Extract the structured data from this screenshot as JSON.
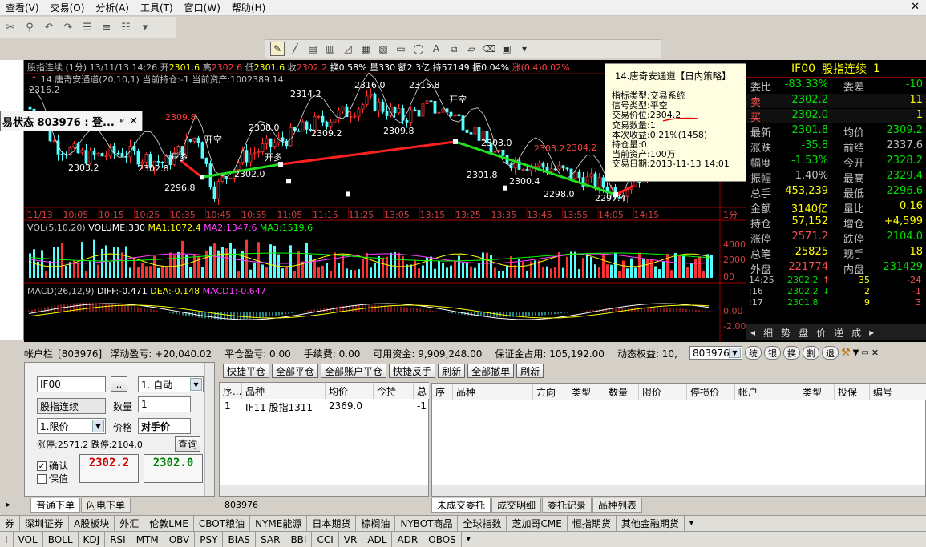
{
  "menu": [
    "查看(V)",
    "交易(O)",
    "分析(A)",
    "工具(T)",
    "窗口(W)",
    "帮助(H)"
  ],
  "chart": {
    "header": {
      "name": "股指连续",
      "period": "(1分)",
      "date": "13/11/13 14:26",
      "open_label": "开",
      "open": "2301.6",
      "high_label": "高",
      "high": "2302.6",
      "low_label": "低",
      "low": "2301.6",
      "close_label": "收",
      "close": "2302.2",
      "turnover": "换0.58%",
      "volume": "量330",
      "amount": "额2.3亿",
      "oi": "持57149",
      "amp": "振0.04%",
      "chg": "涨(0.4)0.02%"
    },
    "strategy_line": "14.唐奇安通道(20,10,1)",
    "position_text": "当前持仓:-1",
    "asset_text": "当前资产:1002389.14",
    "price_labels": [
      {
        "t": "2316.2",
        "c": "#c0c0c0"
      },
      {
        "t": "2314.2",
        "c": "#ffffff"
      },
      {
        "t": "2316.0",
        "c": "#ffffff"
      },
      {
        "t": "2315.8",
        "c": "#ffffff"
      },
      {
        "t": "2309.8",
        "c": "#ff4040"
      },
      {
        "t": "2308.0",
        "c": "#ffffff"
      },
      {
        "t": "2309.2",
        "c": "#ffffff"
      },
      {
        "t": "2309.8",
        "c": "#ffffff"
      },
      {
        "t": "2303.2",
        "c": "#ffffff"
      },
      {
        "t": "2302.8",
        "c": "#ffffff"
      },
      {
        "t": "2302.0",
        "c": "#ffffff"
      },
      {
        "t": "2301.8",
        "c": "#ffffff"
      },
      {
        "t": "2300.4",
        "c": "#ffffff"
      },
      {
        "t": "2298.0",
        "c": "#ffffff"
      },
      {
        "t": "2296.8",
        "c": "#ffffff"
      },
      {
        "t": "2297.4",
        "c": "#ffffff"
      },
      {
        "t": "2304.2",
        "c": "#ff4040"
      },
      {
        "t": "2303.2",
        "c": "#ff4040"
      },
      {
        "t": "2303.0",
        "c": "#ffffff"
      }
    ],
    "signals": [
      "开多",
      "开空",
      "开多",
      "开空"
    ],
    "time_axis": [
      "11/13",
      "10:05",
      "10:15",
      "10:25",
      "10:35",
      "10:45",
      "10:55",
      "11:05",
      "11:15",
      "11:25",
      "13:05",
      "13:15",
      "13:25",
      "13:35",
      "13:45",
      "13:55",
      "14:05",
      "14:15"
    ],
    "period_label": "1分",
    "vol_header": {
      "label": "VOL(5,10,20)",
      "volume": "VOLUME:330",
      "ma1": "MA1:1072.4",
      "ma2": "MA2:1347.6",
      "ma3": "MA3:1519.6"
    },
    "vol_axis": [
      "4000",
      "2000",
      "00"
    ],
    "macd_header": {
      "label": "MACD(26,12,9)",
      "diff": "DIFF:-0.471",
      "dea": "DEA:-0.148",
      "macd1": "MACD1:-0.647"
    },
    "macd_axis": [
      "0.00",
      "-2.00"
    ]
  },
  "popup": {
    "title": "14.唐奇安通道【日内策略】",
    "lines": [
      "指标类型:交易系统",
      "信号类型:平空",
      "交易价位:2304.2",
      "交易数量:1",
      "本次收益:0.21%(1458)",
      "持仓量:0",
      "当前资产:100万",
      "交易日期:2013-11-13 14:01"
    ]
  },
  "trade_state": {
    "title": "易状态 803976 : 登...",
    "pin": "ᵖ",
    "close": "✕"
  },
  "quote": {
    "code": "IF00",
    "name": "股指连续",
    "num": "1",
    "rows": [
      {
        "l": "委比",
        "v": "-83.33%",
        "vc": "#00e000",
        "l2": "委差",
        "v2": "-10",
        "v2c": "#00e000"
      },
      {
        "l": "卖",
        "v": "2302.2",
        "vc": "#00e000",
        "l2": "",
        "v2": "11",
        "v2c": "#ffff00",
        "lc": "#ff5050"
      },
      {
        "l": "买",
        "v": "2302.0",
        "vc": "#00e000",
        "l2": "",
        "v2": "1",
        "v2c": "#ffff00",
        "lc": "#ff5050"
      },
      {
        "l": "最新",
        "v": "2301.8",
        "vc": "#00e000",
        "l2": "均价",
        "v2": "2309.2",
        "v2c": "#00e000"
      },
      {
        "l": "涨跌",
        "v": "-35.8",
        "vc": "#00e000",
        "l2": "前结",
        "v2": "2337.6",
        "v2c": "#c0c0c0"
      },
      {
        "l": "幅度",
        "v": "-1.53%",
        "vc": "#00e000",
        "l2": "今开",
        "v2": "2328.2",
        "v2c": "#00e000"
      },
      {
        "l": "振幅",
        "v": "1.40%",
        "vc": "#c0c0c0",
        "l2": "最高",
        "v2": "2329.4",
        "v2c": "#00e000"
      },
      {
        "l": "总手",
        "v": "453,239",
        "vc": "#ffff00",
        "l2": "最低",
        "v2": "2296.6",
        "v2c": "#00e000"
      },
      {
        "l": "金额",
        "v": "3140亿",
        "vc": "#ffff00",
        "l2": "量比",
        "v2": "0.16",
        "v2c": "#ffff00"
      },
      {
        "l": "持仓",
        "v": "57,152",
        "vc": "#ffff00",
        "l2": "增仓",
        "v2": "+4,599",
        "v2c": "#ffff00"
      },
      {
        "l": "涨停",
        "v": "2571.2",
        "vc": "#ff5050",
        "l2": "跌停",
        "v2": "2104.0",
        "v2c": "#00e000"
      },
      {
        "l": "总笔",
        "v": "25825",
        "vc": "#ffff00",
        "l2": "现手",
        "v2": "18",
        "v2c": "#ffff00"
      },
      {
        "l": "外盘",
        "v": "221774",
        "vc": "#ff5050",
        "l2": "内盘",
        "v2": "231429",
        "v2c": "#00e000"
      }
    ],
    "ticks": [
      {
        "time": "14:25",
        "price": "2302.2",
        "dir": "↑",
        "vol": "35",
        "chg": "-24"
      },
      {
        "time": ":16",
        "price": "2302.2",
        "dir": "↓",
        "vol": "2",
        "chg": "-1"
      },
      {
        "time": ":17",
        "price": "2301.8",
        "dir": "",
        "vol": "9",
        "chg": "3"
      }
    ],
    "tabs": [
      "细",
      "势",
      "盘",
      "价",
      "逆",
      "成"
    ]
  },
  "account": {
    "label": "帐户栏",
    "id": "[803976]",
    "float_pnl": "浮动盈亏: +20,040.02",
    "close_pnl": "平仓盈亏: 0.00",
    "fee": "手续费: 0.00",
    "avail": "可用资金: 9,909,248.00",
    "margin": "保证金占用: 105,192.00",
    "equity": "动态权益: 10,",
    "acct_select": "803976",
    "round_btns": [
      "统",
      "银",
      "换",
      "割",
      "退"
    ]
  },
  "order": {
    "code": "IF00",
    "name": "股指连续",
    "mode": "1. 自动",
    "qty_label": "数量",
    "qty": "1",
    "price_type": "1.限价",
    "price_label": "价格",
    "price": "对手价",
    "limit_text": "涨停:2571.2 跌停:2104.0",
    "query": "查询",
    "confirm": "确认",
    "keep": "保值",
    "buy_price": "2302.2",
    "sell_price": "2302.0",
    "ellipsis": ".."
  },
  "action_buttons": [
    "快捷平仓",
    "全部平仓",
    "全部账户平仓",
    "快捷反手",
    "刷新",
    "全部撤单",
    "刷新"
  ],
  "positions": {
    "headers": [
      "序...",
      "品种",
      "均价",
      "今持",
      "总"
    ],
    "rows": [
      {
        "no": "1",
        "name": "IF11 股指1311",
        "avg": "2369.0",
        "today": "",
        "total": "-1"
      }
    ],
    "footer": "803976"
  },
  "orders": {
    "headers": [
      "序",
      "品种",
      "方向",
      "类型",
      "数量",
      "限价",
      "停损价",
      "帐户",
      "类型",
      "投保",
      "编号"
    ]
  },
  "tabs_left": [
    "普通下单",
    "闪电下单"
  ],
  "tabs_right": [
    "未成交委托",
    "成交明细",
    "委托记录",
    "品种列表"
  ],
  "market_tabs": [
    "券",
    "深圳证券",
    "A股板块",
    "外汇",
    "伦敦LME",
    "CBOT粮油",
    "NYME能源",
    "日本期货",
    "棕榈油",
    "NYBOT商品",
    "全球指数",
    "芝加哥CME",
    "恒指期货",
    "其他金融期货"
  ],
  "indicator_tabs": [
    "I",
    "VOL",
    "BOLL",
    "KDJ",
    "RSI",
    "MTM",
    "OBV",
    "PSY",
    "BIAS",
    "SAR",
    "BBI",
    "CCI",
    "VR",
    "ADL",
    "ADR",
    "OBOS"
  ]
}
